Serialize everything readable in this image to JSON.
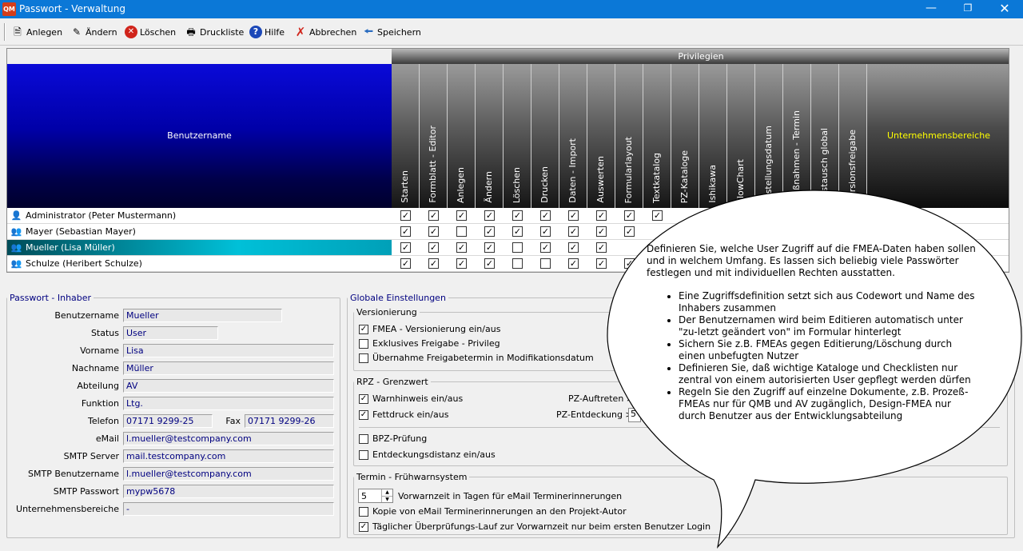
{
  "window": {
    "title": "Passwort - Verwaltung",
    "app_icon": "QM"
  },
  "toolbar": {
    "anlegen": "Anlegen",
    "aendern": "Ändern",
    "loeschen": "Löschen",
    "druckliste": "Druckliste",
    "hilfe": "Hilfe",
    "abbrechen": "Abbrechen",
    "speichern": "Speichern"
  },
  "grid": {
    "privileges_header": "Privilegien",
    "user_header": "Benutzername",
    "areas_header": "Unternehmensbereiche",
    "columns": [
      "Starten",
      "Formblatt - Editor",
      "Anlegen",
      "Ändern",
      "Löschen",
      "Drucken",
      "Daten - Import",
      "Auswerten",
      "Formularlayout",
      "Textkatalog",
      "PZ-Kataloge",
      "Ishikawa",
      "FlowChart",
      "Erstellungsdatum",
      "Maßnahmen - Termin",
      "Austausch global",
      "Versionsfreigabe"
    ],
    "rows": [
      {
        "name": "Administrator  (Peter Mustermann)",
        "checks": [
          true,
          true,
          true,
          true,
          true,
          true,
          true,
          true,
          true,
          true
        ]
      },
      {
        "name": "Mayer  (Sebastian Mayer)",
        "checks": [
          true,
          true,
          false,
          true,
          true,
          true,
          true,
          true,
          true
        ]
      },
      {
        "name": "Mueller  (Lisa Müller)",
        "checks": [
          true,
          true,
          true,
          true,
          false,
          true,
          true,
          true
        ]
      },
      {
        "name": "Schulze  (Heribert Schulze)",
        "checks": [
          true,
          true,
          true,
          true,
          false,
          false,
          true,
          true,
          true
        ]
      }
    ]
  },
  "owner": {
    "legend": "Passwort - Inhaber",
    "benutzername_label": "Benutzername",
    "benutzername": "Mueller",
    "status_label": "Status",
    "status": "User",
    "vorname_label": "Vorname",
    "vorname": "Lisa",
    "nachname_label": "Nachname",
    "nachname": "Müller",
    "abteilung_label": "Abteilung",
    "abteilung": "AV",
    "funktion_label": "Funktion",
    "funktion": "Ltg.",
    "telefon_label": "Telefon",
    "telefon": "07171 9299-25",
    "fax_label": "Fax",
    "fax": "07171 9299-26",
    "email_label": "eMail",
    "email": "l.mueller@testcompany.com",
    "smtp_server_label": "SMTP Server",
    "smtp_server": "mail.testcompany.com",
    "smtp_user_label": "SMTP Benutzername",
    "smtp_user": "l.mueller@testcompany.com",
    "smtp_pw_label": "SMTP Passwort",
    "smtp_pw": "mypw5678",
    "bereiche_label": "Unternehmensbereiche",
    "bereiche": "-"
  },
  "global": {
    "legend": "Globale Einstellungen",
    "versionierung_legend": "Versionierung",
    "fmea_version": "FMEA - Versionierung ein/aus",
    "exklusiv": "Exklusives Freigabe - Privileg",
    "uebernahme": "Übernahme Freigabetermin in Modifikationsdatum",
    "rpz_legend": "RPZ - Grenzwert",
    "warnhinweis": "Warnhinweis ein/aus",
    "fettdruck": "Fettdruck ein/aus",
    "pz_auftreten": "PZ-Auftreten >",
    "pz_entdeckung": "PZ-Entdeckung >",
    "pz_entdeckung_value": "5",
    "bpz": "BPZ-Prüfung",
    "entdeckungsdistanz": "Entdeckungsdistanz ein/aus",
    "termin_legend": "Termin - Frühwarnsystem",
    "vorwarnzeit_value": "5",
    "vorwarnzeit": "Vorwarnzeit in Tagen für eMail Terminerinnerungen",
    "kopie": "Kopie von eMail Terminerinnerungen an den Projekt-Autor",
    "taeglich": "Täglicher Überprüfungs-Lauf zur Vorwarnzeit nur beim ersten Benutzer Login"
  },
  "balloon": {
    "intro": "Definieren Sie, welche User Zugriff auf die FMEA-Daten haben sollen und in welchem Umfang. Es lassen sich beliebig viele Passwörter festlegen und mit individuellen Rechten ausstatten.",
    "bullets": [
      "Eine Zugriffsdefinition setzt sich aus Codewort und Name des Inhabers zusammen",
      "Der Benutzernamen wird beim Editieren automatisch unter \"zu-letzt geändert von\" im Formular hinterlegt",
      "Sichern Sie z.B. FMEAs gegen Editierung/Löschung durch einen unbefugten Nutzer",
      "Definieren Sie, daß wichtige Kataloge und Checklisten nur zentral von einem autorisierten User gepflegt werden dürfen",
      "Regeln Sie den Zugriff auf einzelne Dokumente, z.B. Prozeß-FMEAs nur für QMB und AV zugänglich, Design-FMEA nur durch Benutzer aus der Entwicklungsabteilung"
    ]
  }
}
